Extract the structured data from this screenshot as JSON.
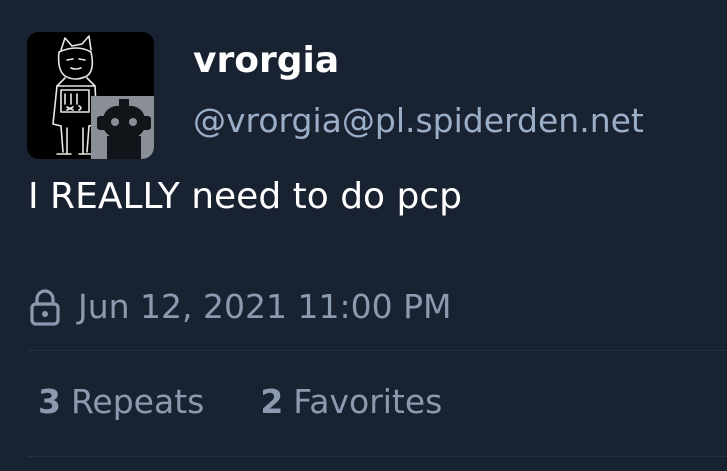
{
  "status": {
    "display_name": "vrorgia",
    "account": "@vrorgia@pl.spiderden.net",
    "content": "I REALLY need to do pcp",
    "visibility_icon": "lock-icon",
    "timestamp": "Jun 12, 2021 11:00 PM",
    "repeats_count": "3",
    "repeats_label": "Repeats",
    "favorites_count": "2",
    "favorites_label": "Favorites"
  },
  "colors": {
    "background": "#192230",
    "text_primary": "#ffffff",
    "text_secondary": "#9baec8",
    "text_muted": "#8c9ab0",
    "divider": "#26303f"
  }
}
